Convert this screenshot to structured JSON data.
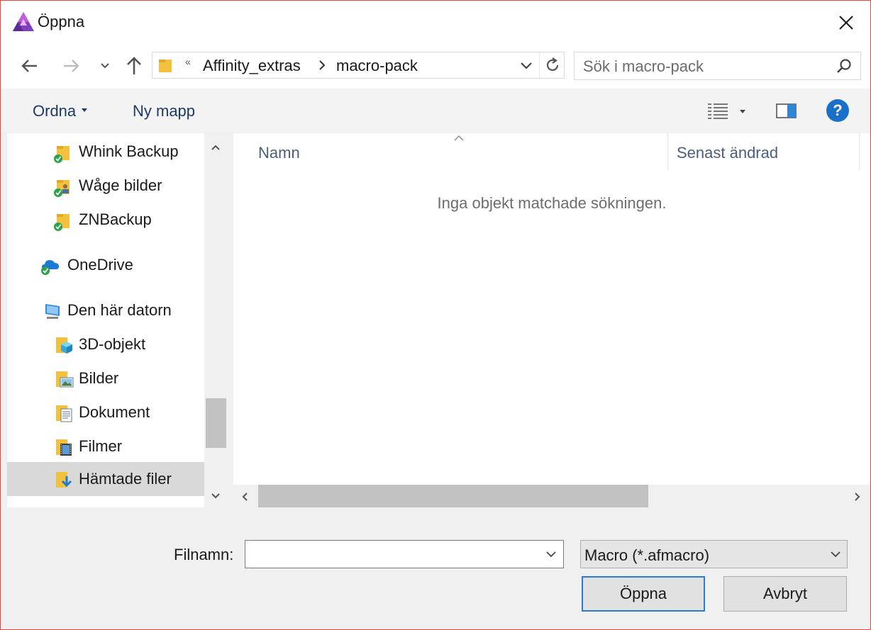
{
  "window": {
    "title": "Öppna",
    "close_icon": "close-icon"
  },
  "address_bar": {
    "overflow_marker": "«",
    "crumbs": [
      "Affinity_extras",
      "macro-pack"
    ]
  },
  "search": {
    "placeholder": "Sök i macro-pack"
  },
  "toolbar": {
    "organize_label": "Ordna",
    "new_folder_label": "Ny mapp",
    "help_label": "?"
  },
  "nav_tree": {
    "items": [
      {
        "label": "Whink Backup",
        "icon": "folder-synced-icon"
      },
      {
        "label": "Wåge bilder",
        "icon": "folder-shared-synced-icon"
      },
      {
        "label": "ZNBackup",
        "icon": "folder-synced-icon"
      },
      {
        "label": "OneDrive",
        "icon": "onedrive-cloud-icon"
      },
      {
        "label": "Den här datorn",
        "icon": "this-pc-icon"
      },
      {
        "label": "3D-objekt",
        "icon": "3d-objects-folder-icon"
      },
      {
        "label": "Bilder",
        "icon": "pictures-folder-icon"
      },
      {
        "label": "Dokument",
        "icon": "documents-folder-icon"
      },
      {
        "label": "Filmer",
        "icon": "videos-folder-icon"
      },
      {
        "label": "Hämtade filer",
        "icon": "downloads-folder-icon",
        "selected": true
      }
    ]
  },
  "file_list": {
    "columns": [
      "Namn",
      "Senast ändrad"
    ],
    "empty_message": "Inga objekt matchade sökningen."
  },
  "footer": {
    "filename_label": "Filnamn:",
    "filename_value": "",
    "file_type_value": "Macro (*.afmacro)",
    "open_button": "Öppna",
    "cancel_button": "Avbryt"
  },
  "colors": {
    "window_border": "#e8473d",
    "link_text": "#1e3a66",
    "help_icon": "#1a6fc9",
    "primary_button_border": "#2b7bd4"
  }
}
